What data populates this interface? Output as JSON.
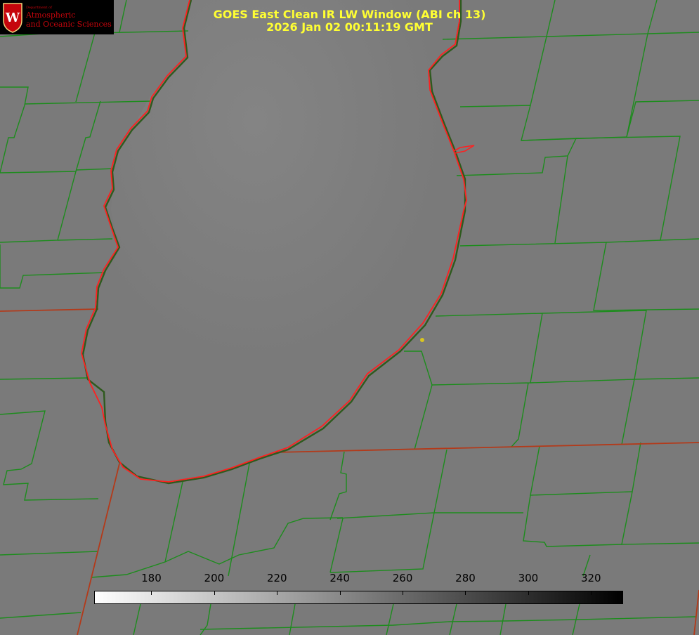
{
  "title": {
    "line1": "GOES East Clean IR LW Window (ABI ch 13)",
    "line2": "2026 Jan 02 00:11:19 GMT"
  },
  "logo": {
    "dept": "Department of",
    "line1": "Atmospheric",
    "line2": "and Oceanic Sciences",
    "crest_letter": "W"
  },
  "colorbar": {
    "ticks": [
      "180",
      "200",
      "220",
      "240",
      "260",
      "280",
      "300",
      "320"
    ],
    "tick_values": [
      180,
      200,
      220,
      240,
      260,
      280,
      300,
      320
    ],
    "vmin": 162,
    "vmax": 330,
    "colormap": "white-to-black grayscale"
  },
  "colors": {
    "background": "#7a7a7a",
    "county_lines": "#1d8c1d",
    "state_lines": "#b33a1a",
    "coastline": "#ff2020",
    "title": "#ffff33",
    "marker": "#d9c520"
  }
}
